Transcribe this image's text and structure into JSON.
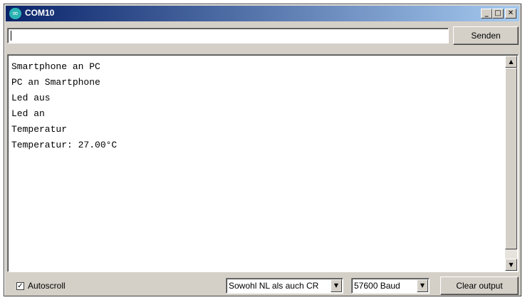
{
  "window": {
    "title": "COM10",
    "logo_glyph": "∞",
    "min_glyph": "_",
    "max_glyph": "□",
    "close_glyph": "✕"
  },
  "send": {
    "input_value": "",
    "button_label": "Senden"
  },
  "output": {
    "lines": [
      "Smartphone an PC",
      "PC an Smartphone",
      "Led aus",
      "Led an",
      "Temperatur",
      "Temperatur: 27.00°C"
    ]
  },
  "scrollbar": {
    "up_glyph": "▲",
    "down_glyph": "▼"
  },
  "footer": {
    "autoscroll_checked": true,
    "autoscroll_check_glyph": "✓",
    "autoscroll_label": "Autoscroll",
    "line_ending": "Sowohl NL als auch CR",
    "baud": "57600 Baud",
    "dropdown_glyph": "▼",
    "clear_label": "Clear output"
  },
  "colors": {
    "titlebar_start": "#0a246a",
    "titlebar_end": "#a6caf0",
    "face": "#d4d0c8",
    "logo": "#2bb3b3"
  }
}
